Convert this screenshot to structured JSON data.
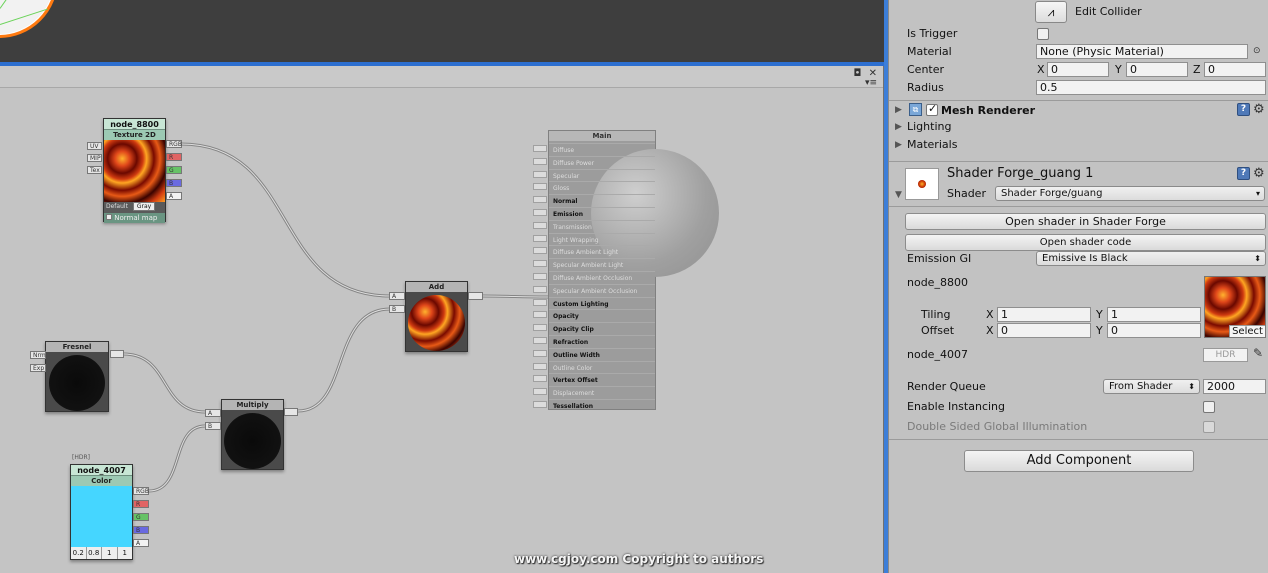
{
  "canvas": {
    "nodes": {
      "texture": {
        "name": "node_8800",
        "type": "Texture 2D",
        "inputs": [
          "UV",
          "MIP",
          "Tex"
        ],
        "outputs": [
          "RGB",
          "R",
          "G",
          "B",
          "A"
        ],
        "default_label": "Default",
        "default_value": "Gray",
        "normal_map_label": "Normal map"
      },
      "fresnel": {
        "type": "Fresnel",
        "inputs": [
          "Nrm",
          "Exp"
        ]
      },
      "multiply": {
        "type": "Multiply",
        "inputs": [
          "A",
          "B"
        ]
      },
      "add": {
        "type": "Add",
        "inputs": [
          "A",
          "B"
        ]
      },
      "color": {
        "hdr_tag": "[HDR]",
        "name": "node_4007",
        "type": "Color",
        "swatch": "#45d6ff",
        "outputs": [
          "RGB",
          "R",
          "G",
          "B",
          "A"
        ],
        "values": [
          "0.2",
          "0.8",
          "1",
          "1"
        ]
      },
      "main": {
        "title": "Main",
        "inputs": [
          {
            "label": "Diffuse",
            "active": false
          },
          {
            "label": "Diffuse Power",
            "active": false
          },
          {
            "label": "Specular",
            "active": false
          },
          {
            "label": "Gloss",
            "active": false
          },
          {
            "label": "Normal",
            "active": true
          },
          {
            "label": "Emission",
            "active": true
          },
          {
            "label": "Transmission",
            "active": false
          },
          {
            "label": "Light Wrapping",
            "active": false
          },
          {
            "label": "Diffuse Ambient Light",
            "active": false
          },
          {
            "label": "Specular Ambient Light",
            "active": false
          },
          {
            "label": "Diffuse Ambient Occlusion",
            "active": false
          },
          {
            "label": "Specular Ambient Occlusion",
            "active": false
          },
          {
            "label": "Custom Lighting",
            "active": true
          },
          {
            "label": "Opacity",
            "active": true
          },
          {
            "label": "Opacity Clip",
            "active": true
          },
          {
            "label": "Refraction",
            "active": true
          },
          {
            "label": "Outline Width",
            "active": true
          },
          {
            "label": "Outline Color",
            "active": false
          },
          {
            "label": "Vertex Offset",
            "active": true
          },
          {
            "label": "Displacement",
            "active": false
          },
          {
            "label": "Tessellation",
            "active": true
          }
        ]
      }
    },
    "watermark": "www.cgjoy.com Copyright to authors"
  },
  "inspector": {
    "collider": {
      "edit_label": "Edit Collider",
      "is_trigger_label": "Is Trigger",
      "material_label": "Material",
      "material_value": "None (Physic Material)",
      "center_label": "Center",
      "center": {
        "x": "0",
        "y": "0",
        "z": "0"
      },
      "radius_label": "Radius",
      "radius_value": "0.5"
    },
    "mesh_renderer": {
      "title": "Mesh Renderer",
      "lighting_label": "Lighting",
      "materials_label": "Materials"
    },
    "material": {
      "title": "Shader Forge_guang 1",
      "shader_label": "Shader",
      "shader_value": "Shader Forge/guang",
      "open_shader_forge": "Open shader in Shader Forge",
      "open_shader_code": "Open shader code",
      "emission_gi_label": "Emission GI",
      "emission_gi_value": "Emissive Is Black",
      "tex_prop_name": "node_8800",
      "tiling_label": "Tiling",
      "offset_label": "Offset",
      "tiling": {
        "x": "1",
        "y": "1"
      },
      "offset": {
        "x": "0",
        "y": "0"
      },
      "select_label": "Select",
      "color_prop_name": "node_4007",
      "hdr_label": "HDR",
      "render_queue_label": "Render Queue",
      "render_queue_mode": "From Shader",
      "render_queue_value": "2000",
      "enable_instancing_label": "Enable Instancing",
      "double_sided_gi_label": "Double Sided Global Illumination"
    },
    "add_component_label": "Add Component",
    "axis": {
      "x": "X",
      "y": "Y",
      "z": "Z"
    }
  }
}
